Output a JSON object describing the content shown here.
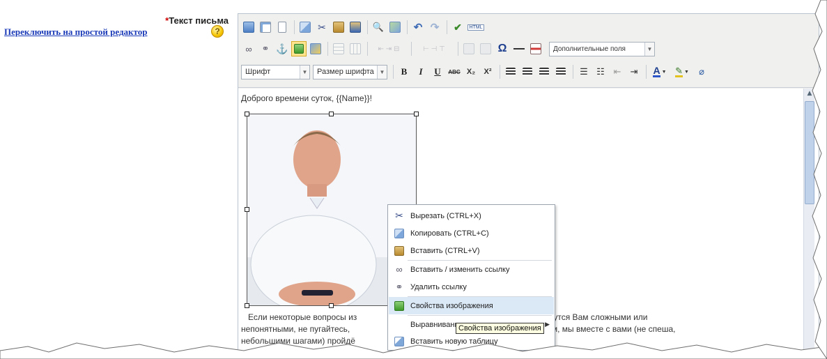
{
  "left": {
    "field_label_req": "*",
    "field_label": "Текст письма",
    "switch_link": "Переключить на простой редактор",
    "help_icon": "?"
  },
  "toolbar": {
    "row1_icons": [
      "source-icon",
      "preview-icon",
      "new-page-icon",
      "copy-icon",
      "cut-icon",
      "paste-icon",
      "paste-word-icon",
      "find-icon",
      "replace-icon",
      "undo-icon",
      "redo-icon",
      "spellcheck-icon",
      "html-icon"
    ],
    "html_label": "HTML",
    "special_char": "Ω",
    "extra_fields": "Дополнительные поля",
    "font_select": "Шрифт",
    "size_select": "Размер шрифта",
    "bold": "B",
    "italic": "I",
    "underline": "U",
    "strike": "ABC",
    "subscript": "X₂",
    "superscript": "X²",
    "font_color": "A"
  },
  "content": {
    "greeting": "Доброго времени суток, {{Name}}!",
    "para_line1_a": "Если некоторые вопросы из",
    "para_line1_b": "исьме, покажутся Вам сложными или",
    "para_line2_a": "непонятными, не пугайтесь, ",
    "para_line2_b": "нейшем, мы вместе с вами (не спеша,",
    "para_line3": "небольшими шагами) пройдё"
  },
  "context_menu": {
    "items": [
      {
        "label": "Вырезать (CTRL+X)",
        "icon": "cut-icon"
      },
      {
        "label": "Копировать (CTRL+C)",
        "icon": "copy-icon"
      },
      {
        "label": "Вставить (CTRL+V)",
        "icon": "paste-icon"
      },
      {
        "label": "Вставить / изменить ссылку",
        "icon": "link-icon"
      },
      {
        "label": "Удалить ссылку",
        "icon": "unlink-icon"
      },
      {
        "label": "Свойства изображения",
        "icon": "image-icon"
      },
      {
        "label": "Выравнивание",
        "icon": "align-icon"
      },
      {
        "label": "Вставить новую таблицу",
        "icon": "table-icon"
      }
    ],
    "submenu_arrow": "▶"
  },
  "tooltip": "Свойства изображения",
  "colors": {
    "link": "#1a3ab8",
    "required": "#d00000",
    "menu_highlight": "#dbe8f6",
    "toolbar_bg": "#f0f0ee"
  }
}
